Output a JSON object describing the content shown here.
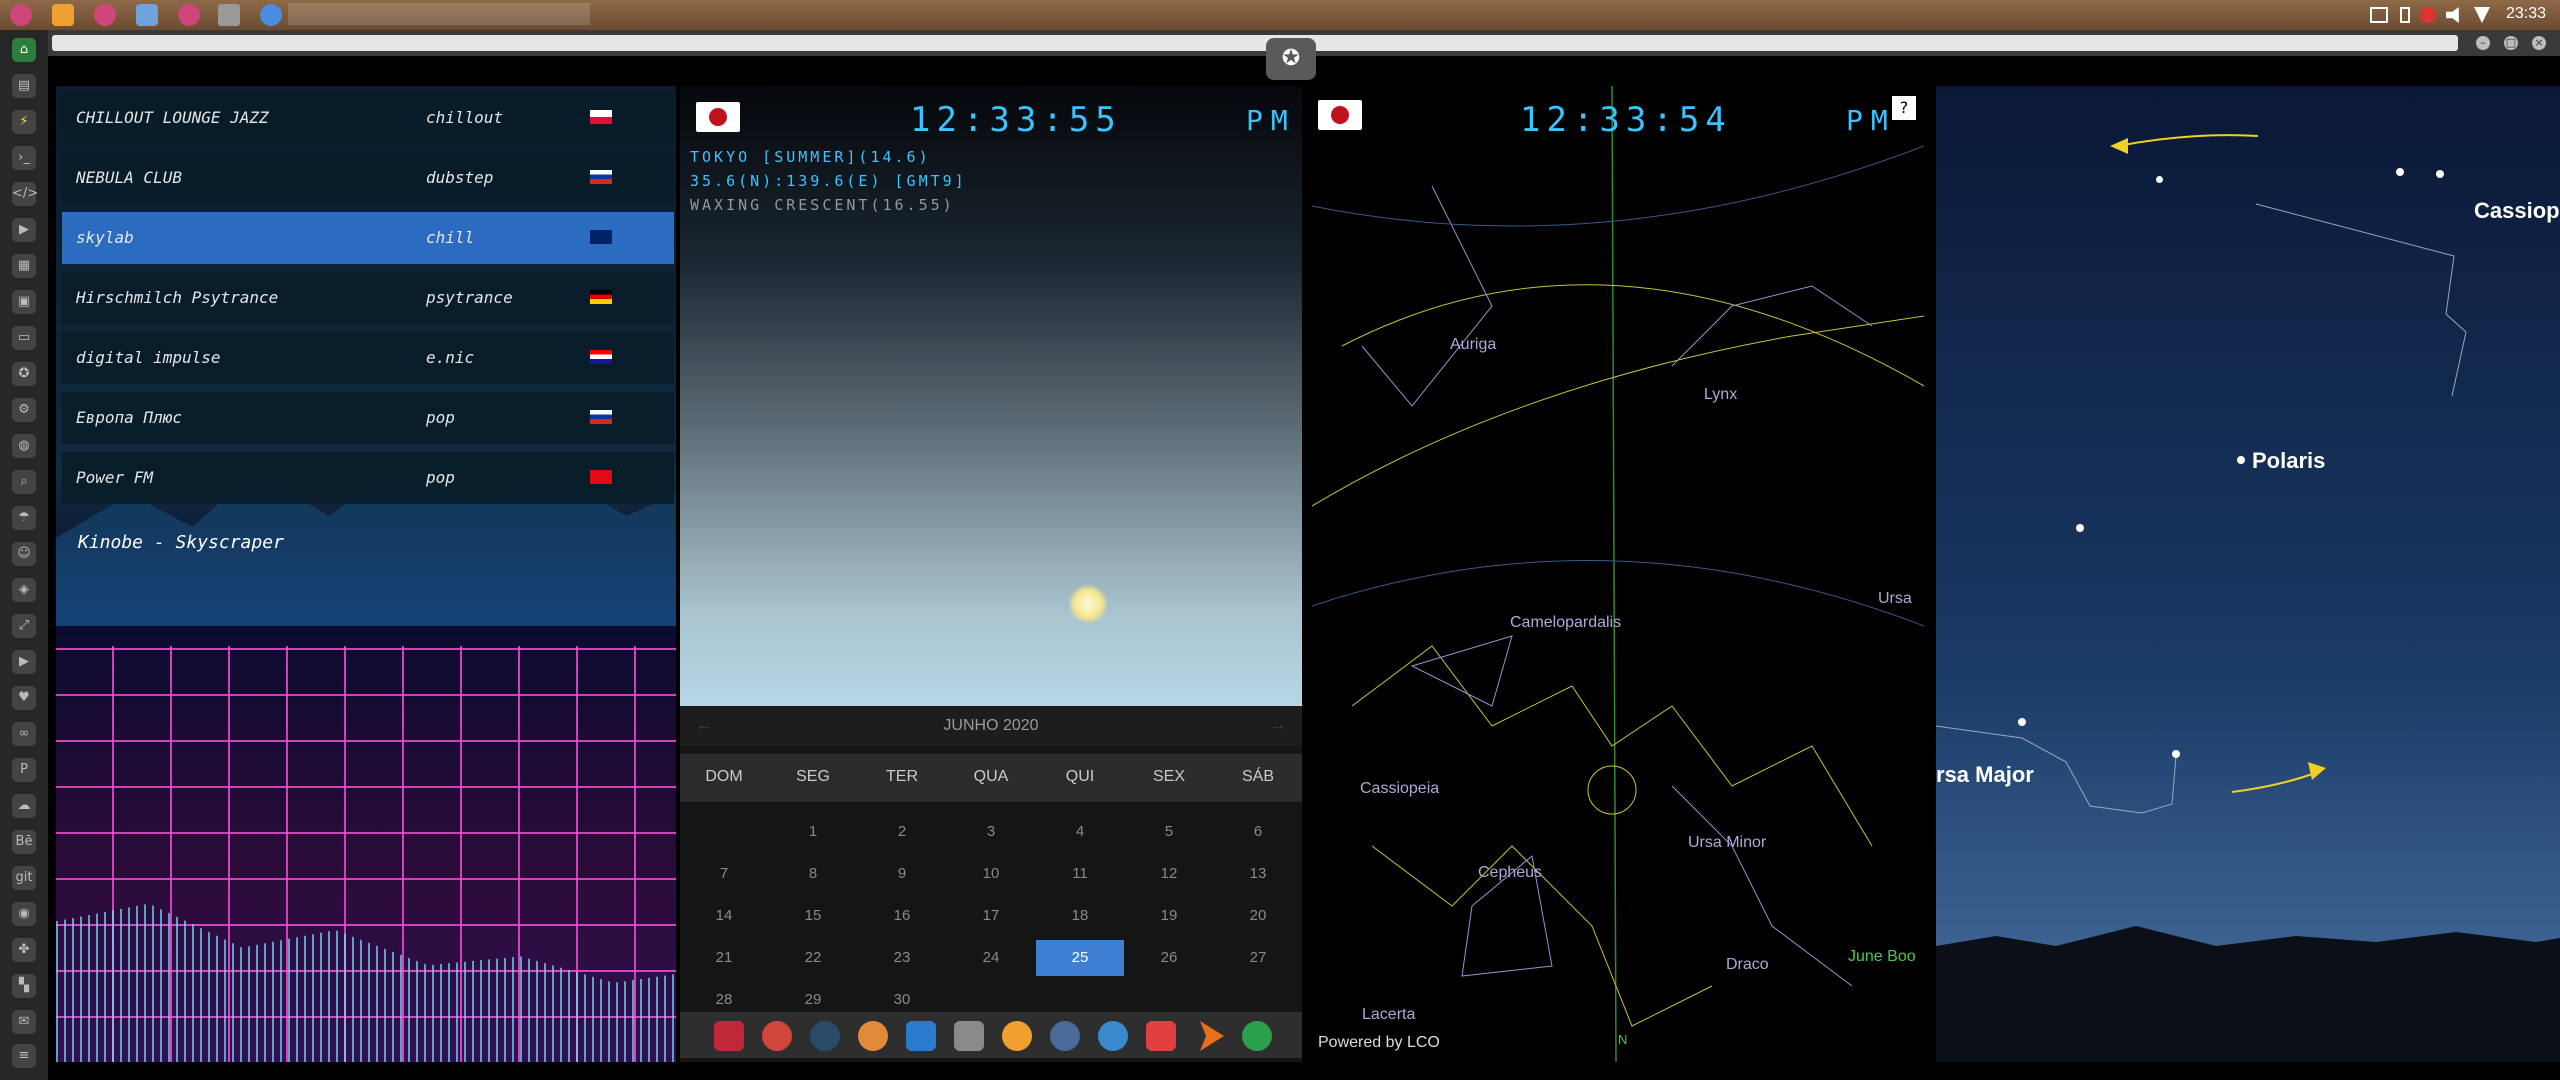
{
  "topbar": {
    "time": "23:33"
  },
  "radio": {
    "stations": [
      {
        "name": "CHILLOUT LOUNGE JAZZ",
        "genre": "chillout",
        "flag": "pl"
      },
      {
        "name": "NEBULA CLUB",
        "genre": "dubstep",
        "flag": "ru"
      },
      {
        "name": "skylab",
        "genre": "chill",
        "flag": "gb"
      },
      {
        "name": "Hirschmilch Psytrance",
        "genre": "psytrance",
        "flag": "de"
      },
      {
        "name": "digital impulse",
        "genre": "e.nic",
        "flag": "hr"
      },
      {
        "name": "Европа Плюс",
        "genre": "pop",
        "flag": "ru"
      },
      {
        "name": "Power FM",
        "genre": "pop",
        "flag": "tr"
      }
    ],
    "now_playing": "Kinobe - Skyscraper"
  },
  "clock": {
    "time": "12:33:55",
    "ampm": "PM",
    "location_line": "TOKYO [SUMMER](14.6)",
    "coords_line": "35.6(N):139.6(E) [GMT9]",
    "moon_line": "WAXING CRESCENT(16.55)"
  },
  "calendar": {
    "month": "JUNHO 2020",
    "days": [
      "DOM",
      "SEG",
      "TER",
      "QUA",
      "QUI",
      "SEX",
      "SÁB"
    ],
    "weeks": [
      [
        "",
        "1",
        "2",
        "3",
        "4",
        "5",
        "6"
      ],
      [
        "7",
        "8",
        "9",
        "10",
        "11",
        "12",
        "13"
      ],
      [
        "14",
        "15",
        "16",
        "17",
        "18",
        "19",
        "20"
      ],
      [
        "21",
        "22",
        "23",
        "24",
        "25",
        "26",
        "27"
      ],
      [
        "28",
        "29",
        "30",
        "",
        "",
        "",
        ""
      ]
    ],
    "today": "25"
  },
  "skymap": {
    "time": "12:33:54",
    "ampm": "PM",
    "help": "?",
    "powered": "Powered by LCO",
    "labels": {
      "auriga": "Auriga",
      "lynx": "Lynx",
      "camelopardalis": "Camelopardalis",
      "ursa": "Ursa",
      "cassiopeia": "Cassiopeia",
      "cepheus": "Cepheus",
      "ursa_minor": "Ursa Minor",
      "draco": "Draco",
      "june_boo": "June Boo",
      "lacerta": "Lacerta",
      "north": "N"
    }
  },
  "night": {
    "cassiop": "Cassiop",
    "polaris": "Polaris",
    "ursa_major": "rsa Major"
  }
}
